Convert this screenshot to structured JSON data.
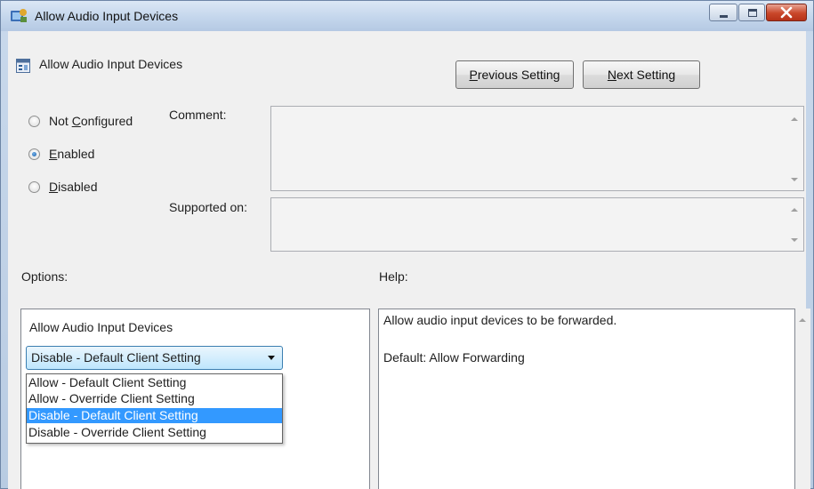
{
  "window": {
    "title": "Allow Audio Input Devices",
    "controls": {
      "minimize": "minimize",
      "maximize": "maximize",
      "close": "close"
    },
    "accent_close": "#c9472a"
  },
  "header": {
    "setting_name": "Allow Audio Input Devices",
    "previous_button": {
      "prefix": "",
      "mnemonic": "P",
      "rest": "revious Setting"
    },
    "next_button": {
      "prefix": "",
      "mnemonic": "N",
      "rest": "ext Setting"
    }
  },
  "state": {
    "options": [
      {
        "prefix": "Not ",
        "mnemonic": "C",
        "rest": "onfigured",
        "checked": false
      },
      {
        "prefix": "",
        "mnemonic": "E",
        "rest": "nabled",
        "checked": true
      },
      {
        "prefix": "",
        "mnemonic": "D",
        "rest": "isabled",
        "checked": false
      }
    ]
  },
  "labels": {
    "comment": "Comment:",
    "supported_on": "Supported on:",
    "options": "Options:",
    "help": "Help:"
  },
  "fields": {
    "comment_value": "",
    "supported_value": ""
  },
  "options_panel": {
    "label": "Allow Audio Input Devices",
    "selected": "Disable - Default Client Setting",
    "dropdown_items": [
      "Allow - Default Client Setting",
      "Allow - Override Client Setting",
      "Disable - Default Client Setting",
      "Disable - Override Client Setting"
    ],
    "highlighted_index": 2,
    "highlight_color": "#3399ff"
  },
  "help_panel": {
    "line1": "Allow audio input devices to be forwarded.",
    "line2": "Default: Allow Forwarding"
  }
}
